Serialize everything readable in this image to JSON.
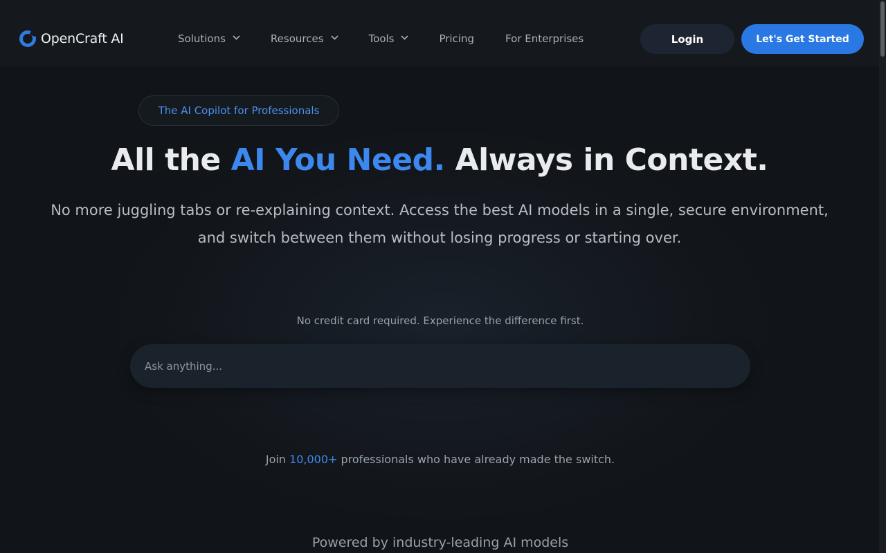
{
  "brand": {
    "name": "OpenCraft AI",
    "accent": "#2a78e4"
  },
  "nav": {
    "items": [
      {
        "label": "Solutions",
        "has_dropdown": true
      },
      {
        "label": "Resources",
        "has_dropdown": true
      },
      {
        "label": "Tools",
        "has_dropdown": true
      },
      {
        "label": "Pricing",
        "has_dropdown": false
      },
      {
        "label": "For Enterprises",
        "has_dropdown": false
      }
    ],
    "login_label": "Login",
    "cta_label": "Let's Get Started"
  },
  "hero": {
    "badge": "The AI Copilot for Professionals",
    "headline_pre": "All the ",
    "headline_accent": "AI You Need.",
    "headline_post": " Always in Context.",
    "subtext": "No more juggling tabs or re-explaining context. Access the best AI models in a single, secure environment, and switch between them without losing progress or starting over.",
    "note": "No credit card required. Experience the difference first.",
    "ask_placeholder": "Ask anything...",
    "join_pre": "Join ",
    "join_count": "10,000+",
    "join_post": " professionals who have already made the switch.",
    "powered": "Powered by industry-leading AI models"
  }
}
